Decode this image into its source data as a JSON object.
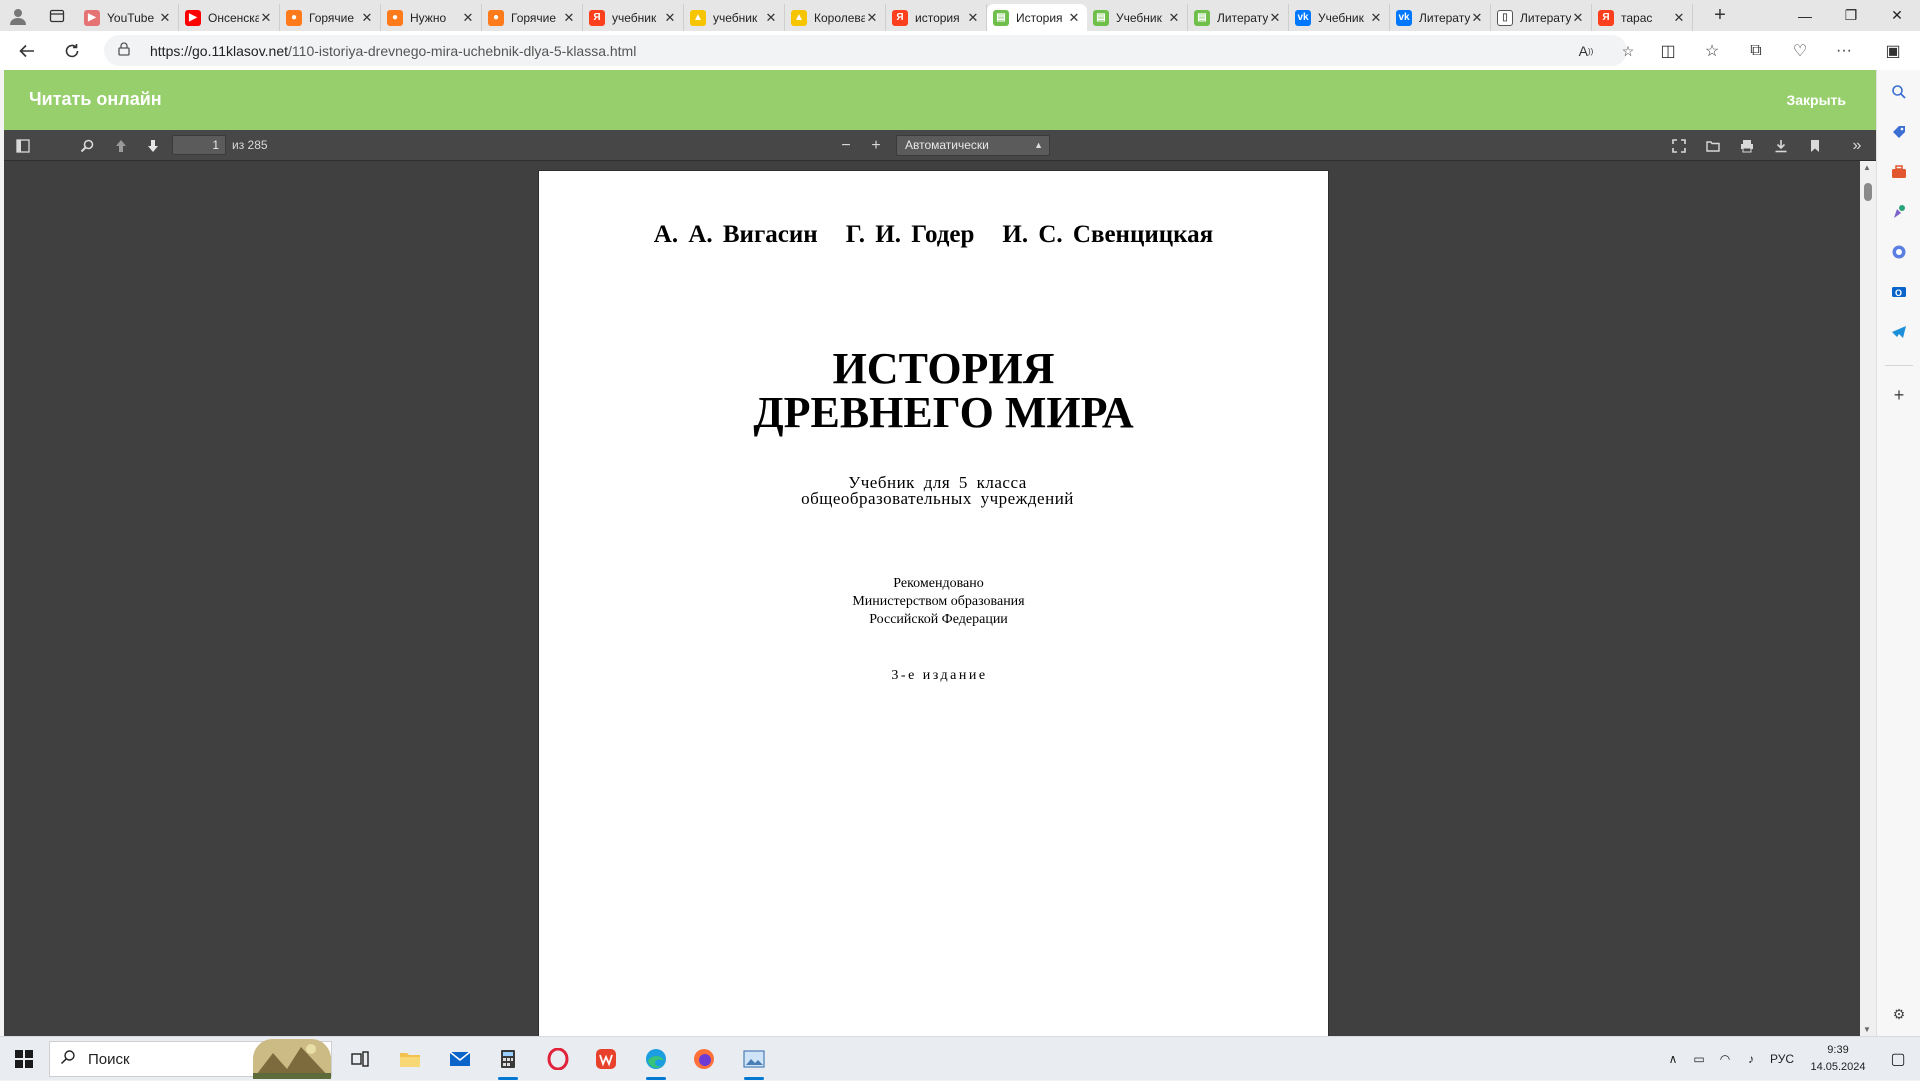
{
  "browser": {
    "tabs": [
      {
        "title": "YouTube",
        "favicon": "youtube-music-icon",
        "color": "#e57373",
        "glyph": "▶"
      },
      {
        "title": "Онсенская",
        "favicon": "youtube-icon",
        "color": "#ff0000",
        "glyph": "▶"
      },
      {
        "title": "Горячие",
        "favicon": "orange-fruit-icon",
        "color": "#ff7a1a",
        "glyph": "●"
      },
      {
        "title": "Нужно",
        "favicon": "orange-fruit-icon",
        "color": "#ff7a1a",
        "glyph": "●"
      },
      {
        "title": "Горячие",
        "favicon": "orange-fruit-icon",
        "color": "#ff7a1a",
        "glyph": "●"
      },
      {
        "title": "учебник",
        "favicon": "yandex-icon",
        "color": "#fc3f1d",
        "glyph": "Я"
      },
      {
        "title": "учебник",
        "favicon": "yellow-landscape-icon",
        "color": "#f7c400",
        "glyph": "▲"
      },
      {
        "title": "Королева",
        "favicon": "yellow-landscape-icon",
        "color": "#f7c400",
        "glyph": "▲"
      },
      {
        "title": "история",
        "favicon": "yandex-icon",
        "color": "#fc3f1d",
        "glyph": "Я"
      },
      {
        "title": "История",
        "favicon": "green-book-icon",
        "color": "#6fbf4a",
        "glyph": "▤",
        "active": true
      },
      {
        "title": "Учебник",
        "favicon": "green-book-icon",
        "color": "#6fbf4a",
        "glyph": "▤"
      },
      {
        "title": "Литература",
        "favicon": "green-book-icon",
        "color": "#6fbf4a",
        "glyph": "▤"
      },
      {
        "title": "Учебник",
        "favicon": "vk-icon",
        "color": "#0077ff",
        "glyph": "vk"
      },
      {
        "title": "Литература",
        "favicon": "vk-icon",
        "color": "#0077ff",
        "glyph": "vk"
      },
      {
        "title": "Литература",
        "favicon": "document-icon",
        "color": "#ffffff",
        "glyph": "▯"
      },
      {
        "title": "тарас",
        "favicon": "yandex-icon",
        "color": "#fc3f1d",
        "glyph": "Я"
      }
    ],
    "new_tab": "+",
    "url_host": "https://go.11klasov.net",
    "url_path": "/110-istoriya-drevnego-mira-uchebnik-dlya-5-klassa.html"
  },
  "site": {
    "header_title": "Читать онлайн",
    "close_label": "Закрыть"
  },
  "pdf_toolbar": {
    "page_number": "1",
    "page_total": "из 285",
    "zoom_value": "Автоматически"
  },
  "document": {
    "authors": [
      "А. А. Вигасин",
      "Г. И. Годер",
      "И. С. Свенцицкая"
    ],
    "title_line1": "ИСТОРИЯ",
    "title_line2": "ДРЕВНЕГО МИРА",
    "subtitle_line1": "Учебник для 5 класса",
    "subtitle_line2": "общеобразовательных учреждений",
    "recommend_line1": "Рекомендовано",
    "recommend_line2": "Министерством образования",
    "recommend_line3": "Российской Федерации",
    "edition": "3-е издание"
  },
  "taskbar": {
    "search_placeholder": "Поиск",
    "language": "РУС",
    "time": "9:39",
    "date": "14.05.2024"
  },
  "colors": {
    "site_accent": "#96cf6c",
    "pdf_toolbar": "#474747",
    "pdf_background": "#404040"
  }
}
